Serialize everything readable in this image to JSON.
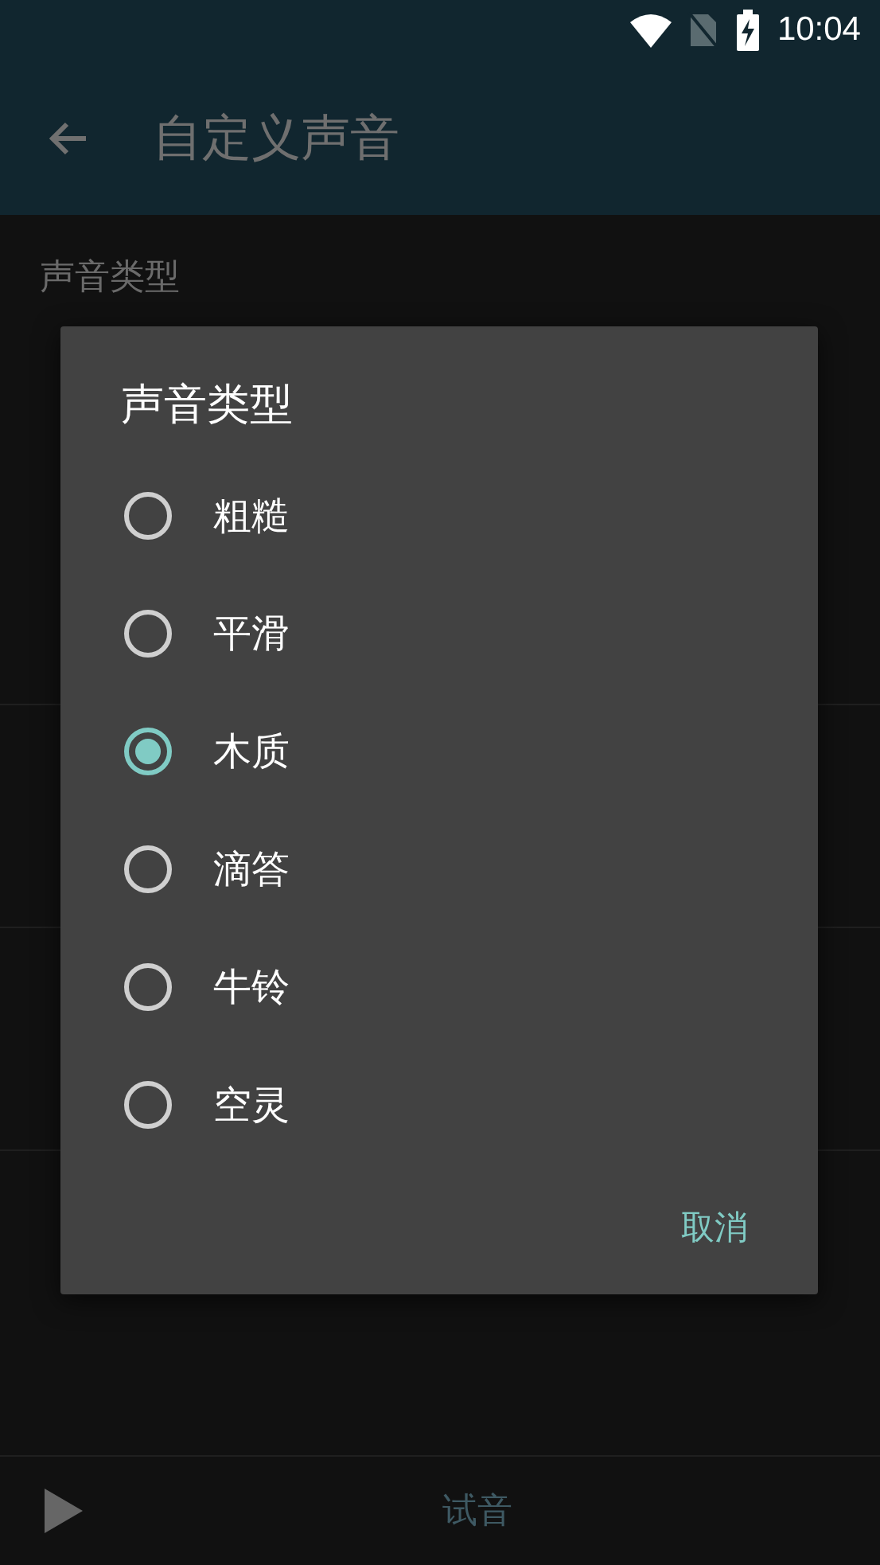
{
  "status_bar": {
    "time": "10:04"
  },
  "app_bar": {
    "title": "自定义声音"
  },
  "first_item": {
    "title": "声音类型"
  },
  "bottom_bar": {
    "label": "试音"
  },
  "dialog": {
    "title": "声音类型",
    "options": [
      {
        "label": "粗糙",
        "selected": false
      },
      {
        "label": "平滑",
        "selected": false
      },
      {
        "label": "木质",
        "selected": true
      },
      {
        "label": "滴答",
        "selected": false
      },
      {
        "label": "牛铃",
        "selected": false
      },
      {
        "label": "空灵",
        "selected": false
      }
    ],
    "buttons": [
      "取消"
    ]
  }
}
